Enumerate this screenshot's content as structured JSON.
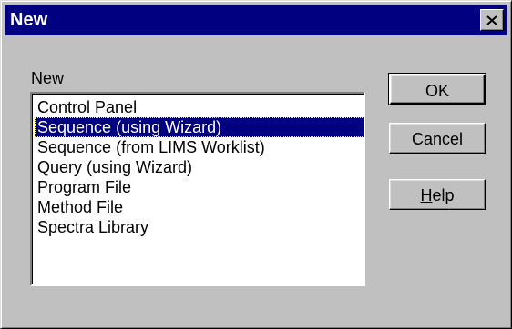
{
  "window": {
    "title": "New"
  },
  "list": {
    "label_accel": "N",
    "label_rest": "ew",
    "items": [
      {
        "label": "Control Panel"
      },
      {
        "label": "Sequence (using Wizard)",
        "selected": true
      },
      {
        "label": "Sequence (from LIMS Worklist)"
      },
      {
        "label": "Query (using Wizard)"
      },
      {
        "label": "Program File"
      },
      {
        "label": "Method File"
      },
      {
        "label": "Spectra Library"
      }
    ]
  },
  "buttons": {
    "ok": "OK",
    "cancel": "Cancel",
    "help_accel": "H",
    "help_rest": "elp"
  },
  "colors": {
    "title_bar": "#000080",
    "face": "#c0c0c0",
    "selection": "#000080"
  },
  "icons": {
    "close": "close-icon"
  }
}
